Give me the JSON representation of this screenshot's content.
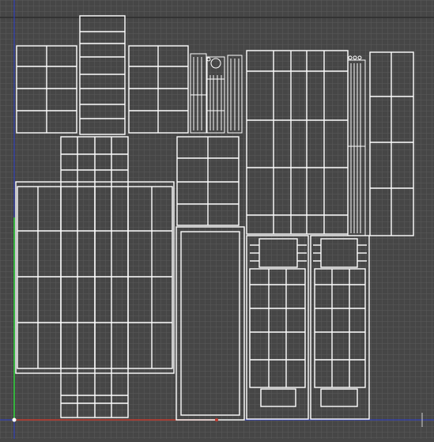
{
  "viewport": {
    "kind": "uv-editor-viewport",
    "background_color": "#464646",
    "grid_color": "#5a5a5a",
    "grid_major_color": "#2e2e2e",
    "uv_line_color": "#ffffff",
    "axis_u_color": "#2c3fd0",
    "axis_v_color": "#2ed63a",
    "axis_u_alt_color": "#c03a2f"
  }
}
